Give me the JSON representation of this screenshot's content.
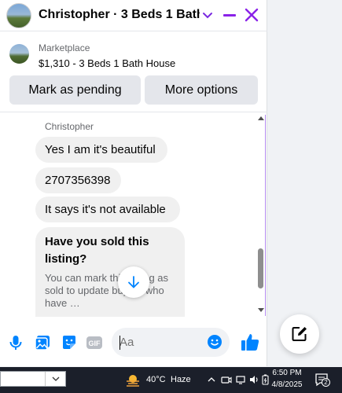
{
  "chat_header": {
    "title": "Christopher · 3 Beds 1 Bath…"
  },
  "marketplace": {
    "label": "Marketplace",
    "item": "$1,310 - 3 Beds 1 Bath House"
  },
  "actions": {
    "mark_pending": "Mark as pending",
    "more_options": "More options"
  },
  "messages": {
    "sender": "Christopher",
    "items": [
      "Yes I am it's beautiful",
      "2707356398",
      "It says it's not available"
    ],
    "card": {
      "title": "Have you sold this listing?",
      "text": "You can mark this listing as sold to update buyers who have …"
    }
  },
  "composer": {
    "placeholder": "Aa"
  },
  "taskbar": {
    "temperature": "40°C",
    "condition": "Haze",
    "time": "6:50 PM",
    "date": "4/8/2025",
    "notification_count": "2"
  },
  "colors": {
    "accent": "#8a22e8",
    "messenger_blue": "#0084ff",
    "bubble_bg": "#f0f0f0",
    "button_bg": "#e4e6eb",
    "taskbar_bg": "#1b1f2a"
  }
}
